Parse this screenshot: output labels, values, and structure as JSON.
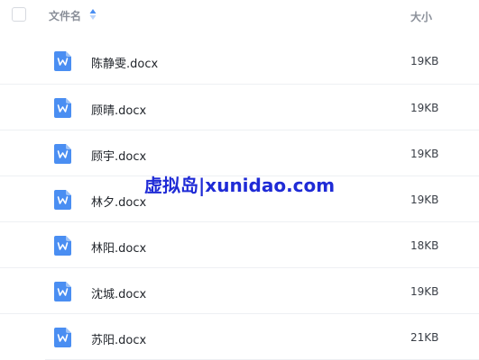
{
  "header": {
    "name_label": "文件名",
    "size_label": "大小",
    "sort_icon": "sort-up-down-icon"
  },
  "files": [
    {
      "name": "陈静雯.docx",
      "size": "19KB",
      "icon": "word-doc-icon"
    },
    {
      "name": "顾晴.docx",
      "size": "19KB",
      "icon": "word-doc-icon"
    },
    {
      "name": "顾宇.docx",
      "size": "19KB",
      "icon": "word-doc-icon"
    },
    {
      "name": "林夕.docx",
      "size": "19KB",
      "icon": "word-doc-icon"
    },
    {
      "name": "林阳.docx",
      "size": "18KB",
      "icon": "word-doc-icon"
    },
    {
      "name": "沈城.docx",
      "size": "19KB",
      "icon": "word-doc-icon"
    },
    {
      "name": "苏阳.docx",
      "size": "21KB",
      "icon": "word-doc-icon"
    }
  ],
  "watermark": "虚拟岛|xunidao.com",
  "colors": {
    "icon_blue": "#4a8ef2",
    "sort_active": "#4a8ef2",
    "sort_inactive": "#b9d3fb",
    "watermark": "#1f2bd6"
  }
}
